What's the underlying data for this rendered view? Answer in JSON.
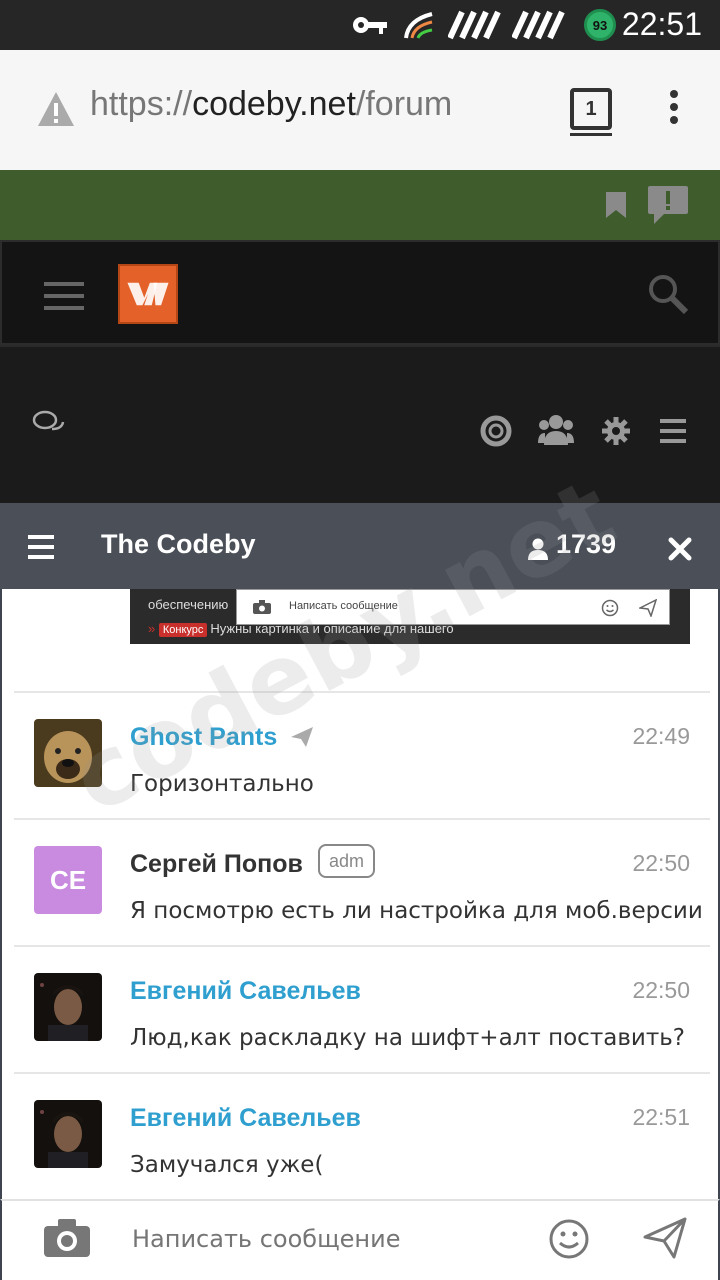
{
  "status_bar": {
    "time": "22:51",
    "battery_level": "93",
    "icons": [
      "key-icon",
      "signal-icon",
      "signal-icon",
      "signal-icon",
      "battery-icon"
    ]
  },
  "browser": {
    "url_prefix": "https://",
    "url_domain": "codeby.net",
    "url_path": "/forum",
    "tab_count": "1",
    "icons": [
      "warning-icon",
      "tab-switcher-icon",
      "overflow-menu-icon"
    ]
  },
  "site_toolbar": {
    "icons": [
      "bookmark-icon",
      "alert-message-icon",
      "menu-icon",
      "logo",
      "search-icon",
      "chat-bubbles-icon",
      "lifebuoy-icon",
      "users-icon",
      "gear-icon",
      "list-icon"
    ]
  },
  "chat": {
    "title": "The Codeby",
    "online_count": "1739",
    "preview": {
      "line1": "обеспечению",
      "input_placeholder": "Написать сообщение",
      "tag": "Конкурс",
      "line2": "Нужны картинка и описание для нашего"
    },
    "messages": [
      {
        "author": "Ghost Pants",
        "time": "22:49",
        "text": "Горизонтально",
        "badge": ""
      },
      {
        "author": "Сергей Попов",
        "initials": "CE",
        "time": "22:50",
        "text": "Я посмотрю есть ли настройка для моб.версии",
        "badge": "adm"
      },
      {
        "author": "Евгений Савельев",
        "time": "22:50",
        "text": "Люд,как раскладку на шифт+алт поставить?",
        "badge": ""
      },
      {
        "author": "Евгений Савельев",
        "time": "22:51",
        "text": "Замучался уже(",
        "badge": ""
      }
    ],
    "compose_placeholder": "Написать сообщение"
  },
  "watermark": "codeby.net",
  "colors": {
    "green_strip": "#3e5c2c",
    "chat_header": "#4a4f58",
    "author_link": "#2e9fcf",
    "admin_avatar": "#c98be0",
    "logo": "#e4622a"
  }
}
